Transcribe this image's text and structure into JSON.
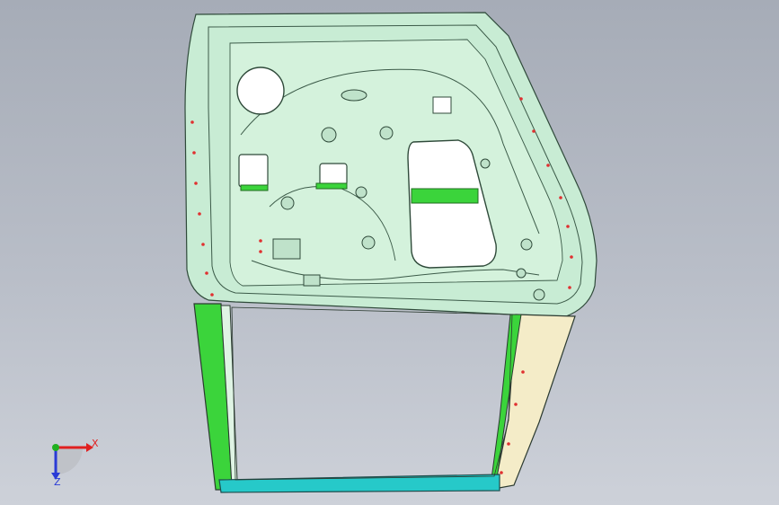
{
  "viewport": {
    "background_top": "#a6acb7",
    "background_bottom": "#cdd1d9"
  },
  "model": {
    "icon": "car-door-inner-panel",
    "panel_color": "#c8ecd4",
    "highlight_color": "#3bd43b",
    "weld_point_color": "#e03030",
    "seal_color": "#26c9c9",
    "reinforcement_color": "#f4ecc8"
  },
  "triad": {
    "x_label": "X",
    "z_label": "Z",
    "x_color": "#e02020",
    "y_color": "#20b020",
    "z_color": "#2a3bd6"
  }
}
